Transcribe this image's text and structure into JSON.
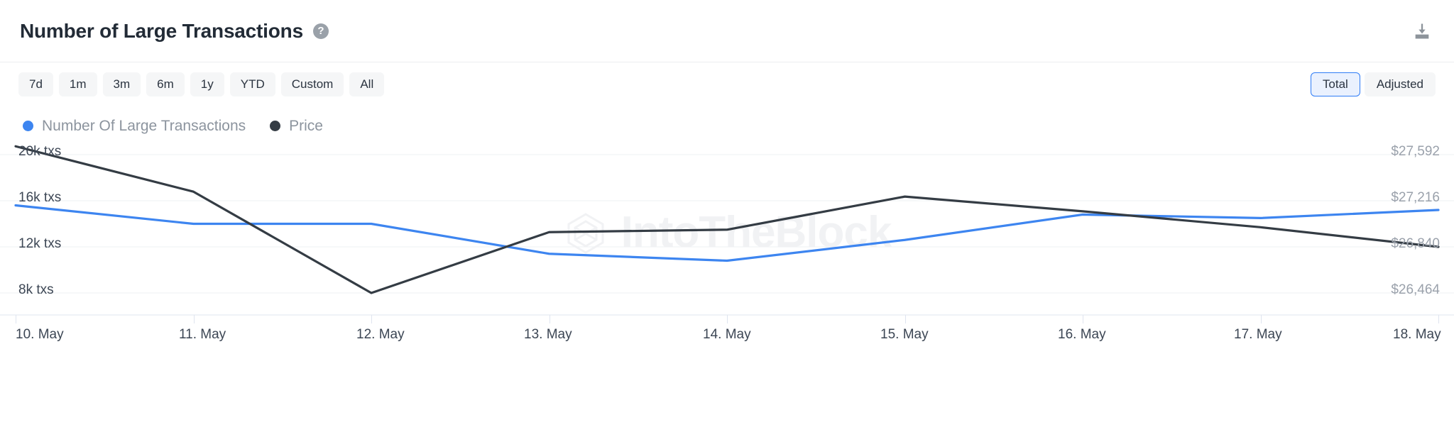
{
  "header": {
    "title": "Number of Large Transactions",
    "help_icon": "question-mark-icon",
    "download_icon": "download-icon"
  },
  "controls": {
    "ranges": [
      {
        "label": "7d",
        "selected": false
      },
      {
        "label": "1m",
        "selected": false
      },
      {
        "label": "3m",
        "selected": false
      },
      {
        "label": "6m",
        "selected": false
      },
      {
        "label": "1y",
        "selected": false
      },
      {
        "label": "YTD",
        "selected": false
      },
      {
        "label": "Custom",
        "selected": false
      },
      {
        "label": "All",
        "selected": false
      }
    ],
    "modes": [
      {
        "label": "Total",
        "selected": true
      },
      {
        "label": "Adjusted",
        "selected": false
      }
    ]
  },
  "legend": [
    {
      "label": "Number Of Large Transactions",
      "color": "#3d85f0"
    },
    {
      "label": "Price",
      "color": "#343c44"
    }
  ],
  "watermark": "IntoTheBlock",
  "colors": {
    "accent": "#2f7cf6",
    "series_transactions": "#3d85f0",
    "series_price": "#343c44",
    "grid": "#eef0f3",
    "axis_text": "#3c4654",
    "axis_text_muted": "#9aa1ab"
  },
  "chart_data": {
    "type": "line",
    "title": "Number of Large Transactions",
    "xlabel": "",
    "ylabel": "",
    "grid": true,
    "legend_position": "top-left",
    "x": [
      "10. May",
      "11. May",
      "12. May",
      "13. May",
      "14. May",
      "15. May",
      "16. May",
      "17. May",
      "18. May"
    ],
    "xtick_labels": [
      "10. May",
      "11. May",
      "12. May",
      "13. May",
      "14. May",
      "15. May",
      "16. May",
      "17. May",
      "18. May"
    ],
    "axes": [
      {
        "name": "left",
        "label_suffix": "txs",
        "tick_labels": [
          "20k txs",
          "16k txs",
          "12k txs",
          "8k txs"
        ],
        "tick_values": [
          20000,
          16000,
          12000,
          8000
        ],
        "ylim": [
          8000,
          20000
        ]
      },
      {
        "name": "right",
        "label_prefix": "$",
        "tick_labels": [
          "$27,592",
          "$27,216",
          "$26,840",
          "$26,464"
        ],
        "tick_values": [
          27592,
          27216,
          26840,
          26464
        ],
        "ylim": [
          26464,
          27592
        ]
      }
    ],
    "series": [
      {
        "name": "Number Of Large Transactions",
        "axis": "left",
        "color": "#3d85f0",
        "unit": "txs",
        "values": [
          15600,
          14000,
          14000,
          11400,
          10800,
          12600,
          14800,
          14500,
          15200
        ]
      },
      {
        "name": "Price",
        "axis": "right",
        "color": "#343c44",
        "unit": "USD",
        "values": [
          27660,
          27290,
          26464,
          26960,
          26980,
          27250,
          27130,
          27000,
          26840
        ]
      }
    ]
  }
}
